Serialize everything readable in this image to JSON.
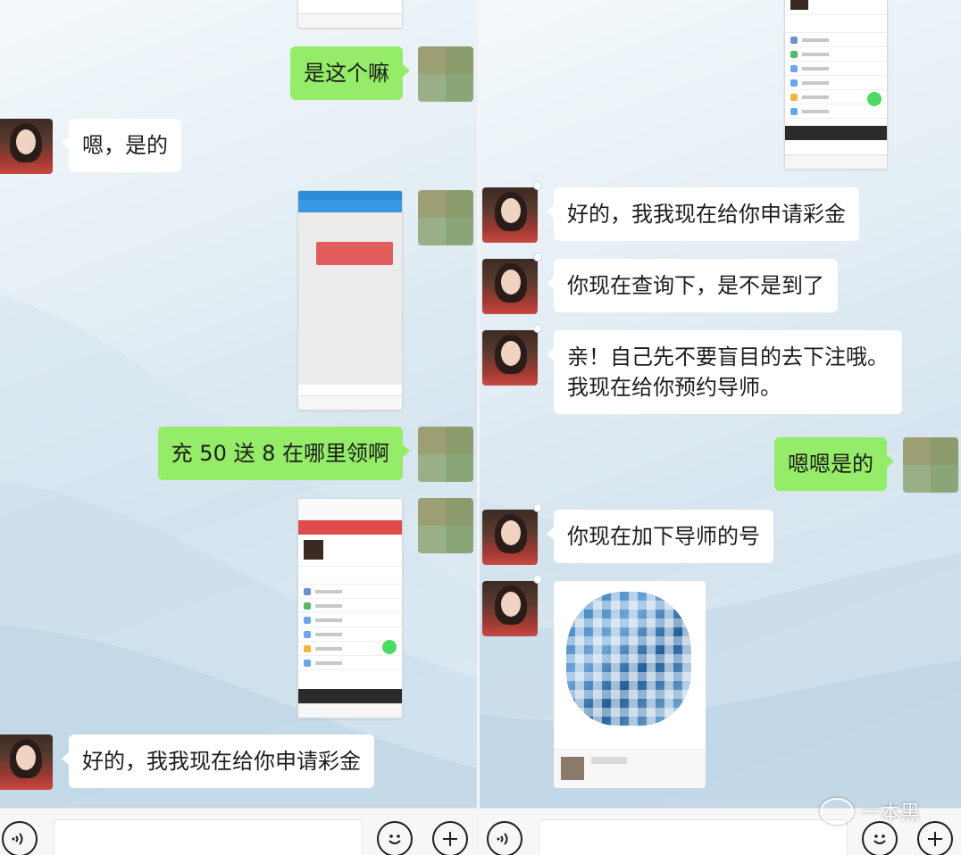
{
  "left_chat": {
    "messages": [
      {
        "side": "out",
        "type": "text",
        "text": "是这个嘛"
      },
      {
        "side": "in",
        "type": "text",
        "text": "嗯，是的"
      },
      {
        "side": "out",
        "type": "image",
        "description": "phone screenshot"
      },
      {
        "side": "out",
        "type": "text",
        "text": "充 50 送 8 在哪里领啊"
      },
      {
        "side": "out",
        "type": "image",
        "description": "phone screenshot"
      },
      {
        "side": "in",
        "type": "text",
        "text": "好的，我我现在给你申请彩金"
      }
    ]
  },
  "right_chat": {
    "messages": [
      {
        "side": "in",
        "type": "text",
        "text": "好的，我我现在给你申请彩金"
      },
      {
        "side": "in",
        "type": "text",
        "text": "你现在查询下，是不是到了"
      },
      {
        "side": "in",
        "type": "text",
        "line1": "亲！自己先不要盲目的去下注哦。",
        "line2": "我现在给你预约导师。"
      },
      {
        "side": "out",
        "type": "text",
        "text": "嗯嗯是的"
      },
      {
        "side": "in",
        "type": "text",
        "text": "你现在加下导师的号"
      },
      {
        "side": "in",
        "type": "contact_card",
        "description": "QR code card"
      }
    ]
  },
  "toolbar": {
    "voice_icon": "voice-icon",
    "emoji_icon": "emoji-icon",
    "plus_icon": "plus-icon"
  },
  "watermark": {
    "text": "一本黑"
  },
  "colors": {
    "outgoing_bubble": "#95ec69",
    "incoming_bubble": "#ffffff"
  }
}
